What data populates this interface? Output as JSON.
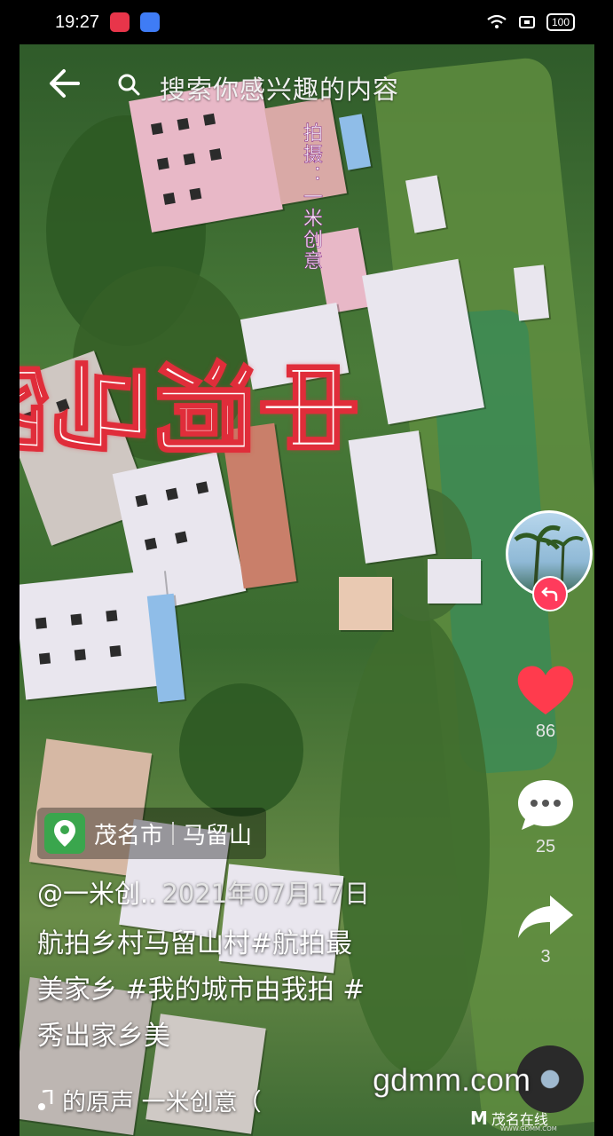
{
  "status_bar": {
    "time": "19:27",
    "battery": "100"
  },
  "search": {
    "text": "搜索你感兴趣的内容"
  },
  "overlay": {
    "title": "中洞马留山",
    "vertical_watermark": "拍摄：一米创意"
  },
  "right_rail": {
    "like_count": "86",
    "comment_count": "25",
    "share_count": "3"
  },
  "location": {
    "city": "茂名市",
    "place": "马留山"
  },
  "post": {
    "author": "@一米创..",
    "date": "2021年07月17日",
    "caption_lines": [
      "航拍乡村马留山村#航拍最",
      "美家乡 #我的城市由我拍 #",
      "秀出家乡美"
    ],
    "music": "的原声 一米创意（"
  },
  "watermark": {
    "site": "gdmm.com",
    "brand": "茂名在线",
    "brand_sub": "WWW.GDMM.COM"
  },
  "colors": {
    "like": "#ff3b4d",
    "overlay_stroke": "#e02d3a",
    "location_pin_bg": "#3aa64d"
  },
  "icons": [
    "back-arrow-icon",
    "search-icon",
    "heart-icon",
    "comment-icon",
    "share-icon",
    "location-pin-icon",
    "music-note-icon",
    "wifi-icon"
  ]
}
